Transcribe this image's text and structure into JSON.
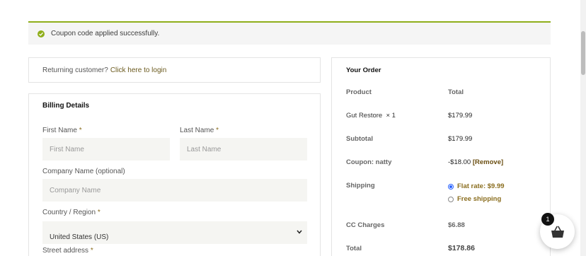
{
  "notice": {
    "message": "Coupon code applied successfully.",
    "icon": "check-circle-icon",
    "accent": "#8fae1b"
  },
  "returning": {
    "question": "Returning customer?",
    "link": "Click here to login"
  },
  "billing": {
    "title": "Billing Details",
    "first_name": {
      "label": "First Name",
      "required": "*",
      "placeholder": "First Name"
    },
    "last_name": {
      "label": "Last Name",
      "required": "*",
      "placeholder": "Last Name"
    },
    "company": {
      "label": "Company Name (optional)",
      "placeholder": "Company Name"
    },
    "country": {
      "label": "Country / Region",
      "required": "*",
      "value": "United States (US)"
    },
    "street": {
      "label": "Street address",
      "required": "*"
    }
  },
  "order": {
    "title": "Your Order",
    "header": {
      "product": "Product",
      "total": "Total"
    },
    "item": {
      "name": "Gut Restore",
      "qty": "× 1",
      "price": "$179.99"
    },
    "subtotal": {
      "label": "Subtotal",
      "value": "$179.99"
    },
    "coupon": {
      "label": "Coupon: natty",
      "value": "-$18.00",
      "remove": "[Remove]"
    },
    "shipping": {
      "label": "Shipping",
      "options": [
        {
          "label": "Flat rate: $9.99",
          "selected": true
        },
        {
          "label": "Free shipping",
          "selected": false
        }
      ]
    },
    "cc_charges": {
      "label": "CC Charges",
      "value": "$6.88"
    },
    "total": {
      "label": "Total",
      "value": "$178.86"
    }
  },
  "cart": {
    "count": "1",
    "icon": "shopping-basket-icon"
  }
}
